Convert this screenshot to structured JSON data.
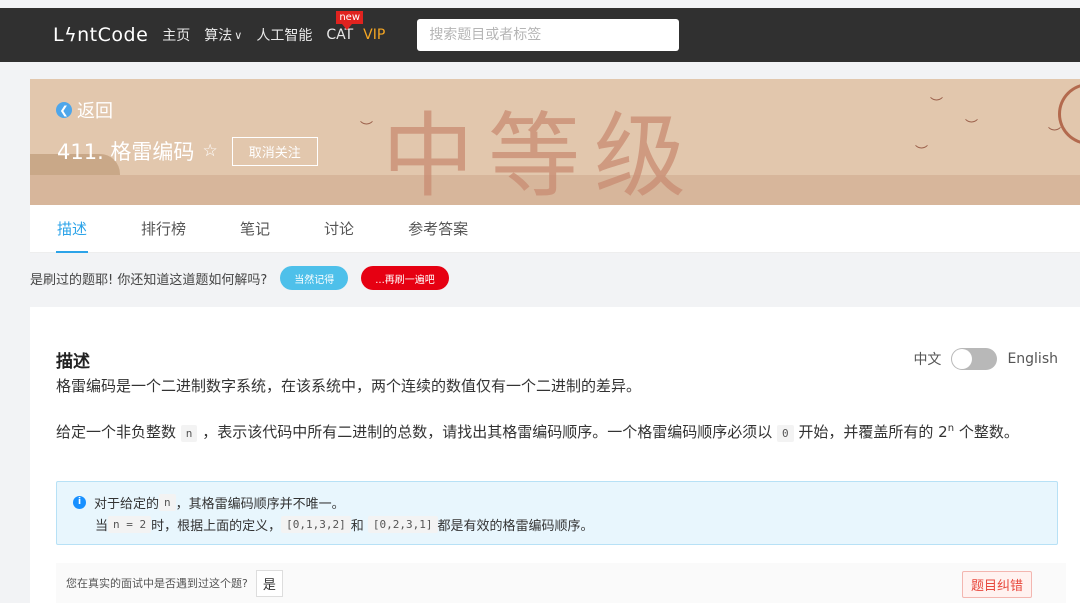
{
  "nav": {
    "logo": "LϟntCode",
    "links": [
      {
        "label": "主页"
      },
      {
        "label": "算法",
        "caret": "∨"
      },
      {
        "label": "人工智能"
      },
      {
        "label": "CAT",
        "badge": "new"
      },
      {
        "label": "VIP"
      }
    ],
    "search_placeholder": "搜索题目或者标签"
  },
  "banner": {
    "back_label": "返回",
    "title": "411. 格雷编码",
    "unfollow_label": "取消关注",
    "difficulty_text": "中等级"
  },
  "tabs": [
    {
      "label": "描述",
      "active": true
    },
    {
      "label": "排行榜"
    },
    {
      "label": "笔记"
    },
    {
      "label": "讨论"
    },
    {
      "label": "参考答案"
    }
  ],
  "reminder": {
    "text": "是刷过的题耶! 你还知道这道题如何解吗?",
    "remember_label": "当然记得",
    "again_label": "...再刷一遍吧"
  },
  "description": {
    "heading": "描述",
    "lang_zh": "中文",
    "lang_en": "English",
    "para1": "格雷编码是一个二进制数字系统，在该系统中，两个连续的数值仅有一个二进制的差异。",
    "para2": {
      "a": "给定一个非负整数",
      "code_n": "n",
      "b": "，表示该代码中所有二进制的总数，请找出其格雷编码顺序。一个格雷编码顺序必须以",
      "code_0": "0",
      "c": "开始，并覆盖所有的 2",
      "sup": "n",
      "d": "个整数。"
    },
    "info": {
      "line1_a": "对于给定的",
      "line1_code": "n",
      "line1_b": "，其格雷编码顺序并不唯一。",
      "line2_a": "当",
      "line2_code": "n = 2",
      "line2_b": "时，根据上面的定义，",
      "line2_code2": "[0,1,3,2]",
      "line2_c": "和",
      "line2_code3": "[0,2,3,1]",
      "line2_d": "都是有效的格雷编码顺序。"
    },
    "interview_question": "您在真实的面试中是否遇到过这个题?",
    "yes_label": "是",
    "report_label": "题目纠错"
  },
  "colors": {
    "nav_bg": "#303030",
    "accent": "#2ca3e8",
    "vip": "#f5a623",
    "danger": "#e60012"
  }
}
